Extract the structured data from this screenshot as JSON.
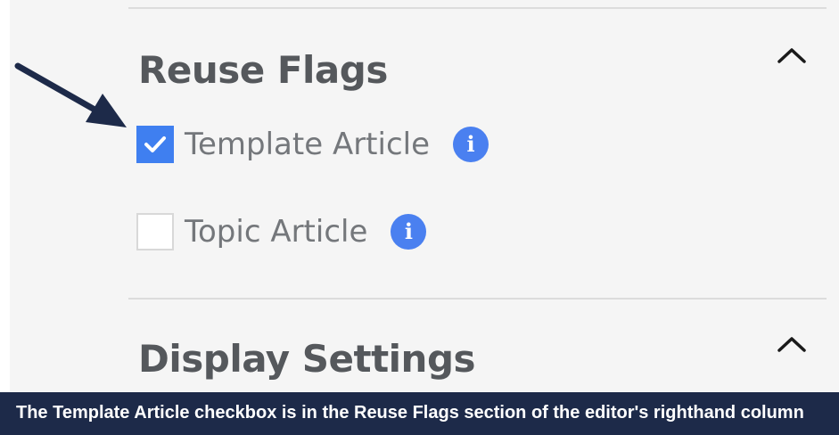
{
  "sections": [
    {
      "title": "Reuse Flags",
      "expanded": true,
      "options": [
        {
          "label": "Template Article",
          "checked": true,
          "info_icon": "info-icon"
        },
        {
          "label": "Topic Article",
          "checked": false,
          "info_icon": "info-icon"
        }
      ]
    },
    {
      "title": "Display Settings",
      "expanded": true
    }
  ],
  "info_glyph": "i",
  "caption": "The Template Article checkbox is in the Reuse Flags section of the editor's righthand column",
  "colors": {
    "checkbox_checked": "#3f7ff0",
    "info_badge": "#4a80f0",
    "caption_bg": "#1d2a49",
    "arrow": "#1d2a49",
    "title_text": "#55585c",
    "option_text": "#74777b"
  }
}
